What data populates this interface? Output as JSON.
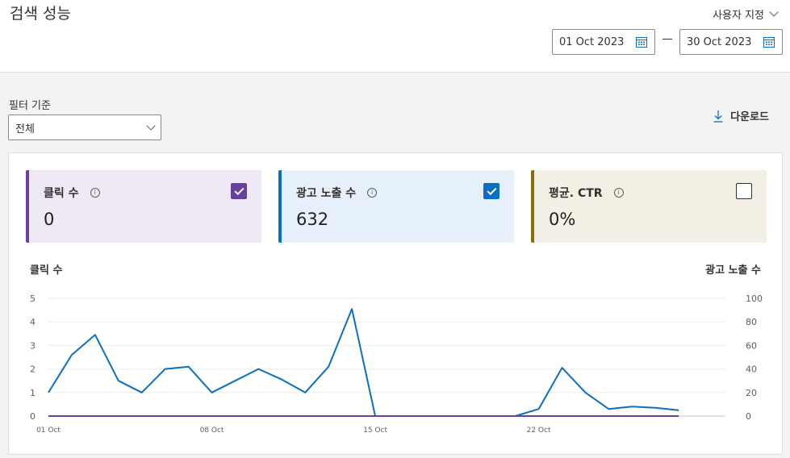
{
  "header": {
    "title": "검색 성능",
    "range_label": "사용자 지정",
    "start_date": "01 Oct 2023",
    "end_date": "30 Oct 2023"
  },
  "filter": {
    "label": "필터 기준",
    "value": "전체"
  },
  "download_label": "다운로드",
  "metrics": [
    {
      "label": "클릭 수",
      "value": "0",
      "checked": true,
      "color": "#6b3fa0",
      "bg": "#efe9f5"
    },
    {
      "label": "광고 노출 수",
      "value": "632",
      "checked": true,
      "color": "#0a6fc2",
      "bg": "#e5f0fa"
    },
    {
      "label": "평균. CTR",
      "value": "0%",
      "checked": false,
      "color": "#8a6d0b",
      "bg": "#f3efe4"
    }
  ],
  "chart_data": {
    "type": "line",
    "left_axis_label": "클릭 수",
    "right_axis_label": "광고 노출 수",
    "x_dates": [
      "01 Oct",
      "02 Oct",
      "03 Oct",
      "04 Oct",
      "05 Oct",
      "06 Oct",
      "07 Oct",
      "08 Oct",
      "09 Oct",
      "10 Oct",
      "11 Oct",
      "12 Oct",
      "13 Oct",
      "14 Oct",
      "15 Oct",
      "16 Oct",
      "17 Oct",
      "18 Oct",
      "19 Oct",
      "20 Oct",
      "21 Oct",
      "22 Oct",
      "23 Oct",
      "24 Oct",
      "25 Oct",
      "26 Oct",
      "27 Oct",
      "28 Oct",
      "29 Oct",
      "30 Oct"
    ],
    "x_tick_labels": [
      "01 Oct",
      "08 Oct",
      "15 Oct",
      "22 Oct"
    ],
    "x_tick_indices": [
      0,
      7,
      14,
      21
    ],
    "left_ticks": [
      0,
      1,
      2,
      3,
      4,
      5
    ],
    "right_ticks": [
      0,
      20,
      40,
      60,
      80,
      100
    ],
    "ylim_left": [
      0,
      5
    ],
    "ylim_right": [
      0,
      100
    ],
    "series": [
      {
        "name": "광고 노출 수",
        "axis": "right",
        "color": "#0a6fc2",
        "values": [
          20,
          52,
          69,
          30,
          20,
          40,
          42,
          20,
          30,
          40,
          31,
          20,
          42,
          91,
          0,
          0,
          0,
          0,
          0,
          0,
          0,
          6,
          41,
          20,
          6,
          8,
          7,
          5,
          null,
          null
        ]
      },
      {
        "name": "클릭 수",
        "axis": "left",
        "color": "#6b3fa0",
        "values": [
          0,
          0,
          0,
          0,
          0,
          0,
          0,
          0,
          0,
          0,
          0,
          0,
          0,
          0,
          0,
          0,
          0,
          0,
          0,
          0,
          0,
          0,
          0,
          0,
          0,
          0,
          0,
          0,
          null,
          null
        ]
      }
    ]
  }
}
